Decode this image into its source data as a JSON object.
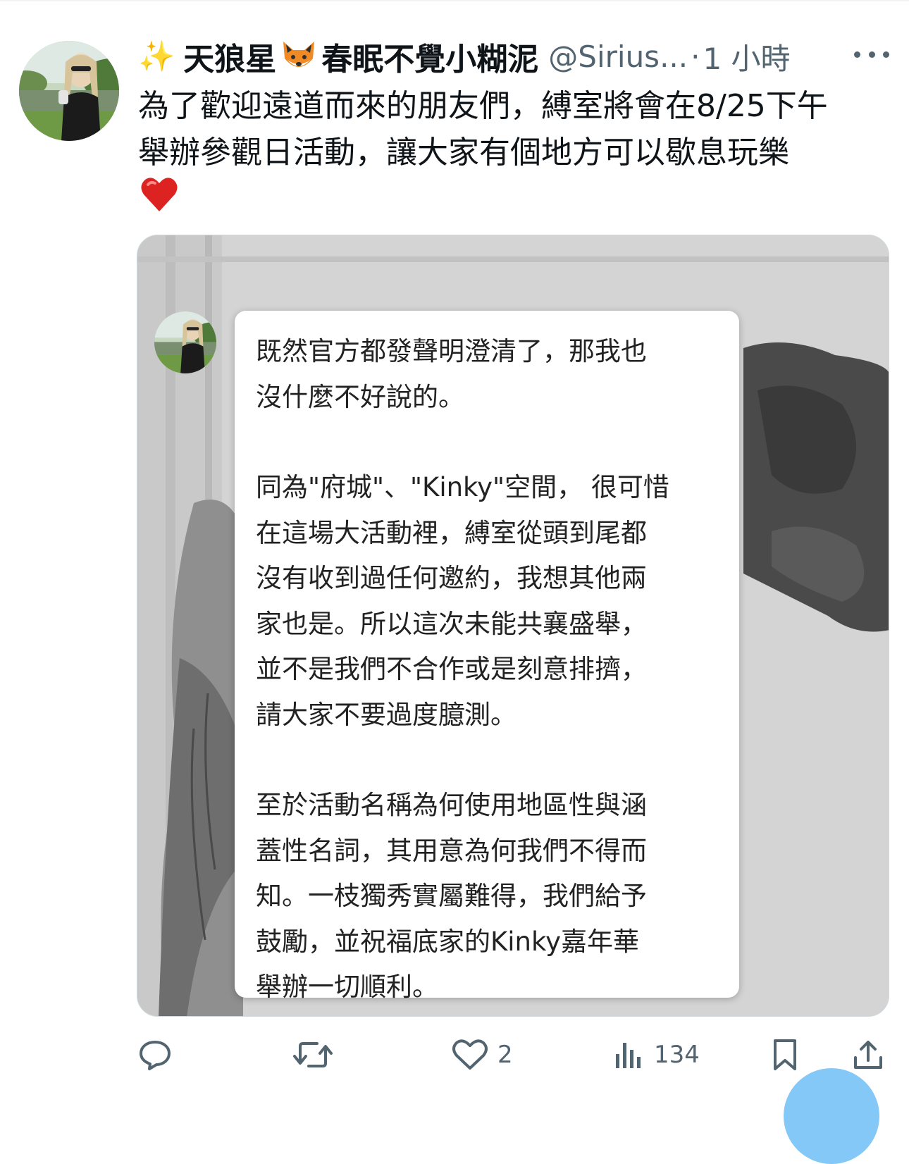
{
  "tweet": {
    "sparkle_emoji": "✨",
    "name_part1": "天狼星",
    "fox_emoji": "🦊",
    "name_part2": "春眠不覺小糊泥",
    "handle": "@Sirius...",
    "separator": "·",
    "time": "1 小時",
    "text_lines": [
      "為了歡迎遠道而來的朋友們，縛室將會在8/25下午",
      "舉辦參觀日活動，讓大家有個地方可以歇息玩樂"
    ],
    "heart_emoji": "❤️"
  },
  "media": {
    "note_paragraphs": [
      [
        " 既然官方都發聲明澄清了，那我也",
        "沒什麼不好說的。"
      ],
      [
        "同為\"府城\"、\"Kinky\"空間， 很可惜",
        "在這場大活動裡，縛室從頭到尾都",
        "沒有收到過任何邀約，我想其他兩",
        "家也是。所以這次未能共襄盛舉，",
        "並不是我們不合作或是刻意排擠，",
        "請大家不要過度臆測。"
      ],
      [
        "至於活動名稱為何使用地區性與涵",
        "蓋性名詞，其用意為何我們不得而",
        "知。一枝獨秀實屬難得，我們給予",
        "鼓勵，並祝福底家的Kinky嘉年華",
        "舉辦一切順利。"
      ]
    ]
  },
  "actions": {
    "reply_icon": "reply-icon",
    "retweet_icon": "retweet-icon",
    "like_icon": "heart-icon",
    "like_count": "2",
    "views_icon": "views-icon",
    "view_count": "134",
    "bookmark_icon": "bookmark-icon",
    "share_icon": "share-icon"
  },
  "colors": {
    "text": "#0f1419",
    "secondary": "#536471",
    "accent": "#1d9bf0"
  }
}
